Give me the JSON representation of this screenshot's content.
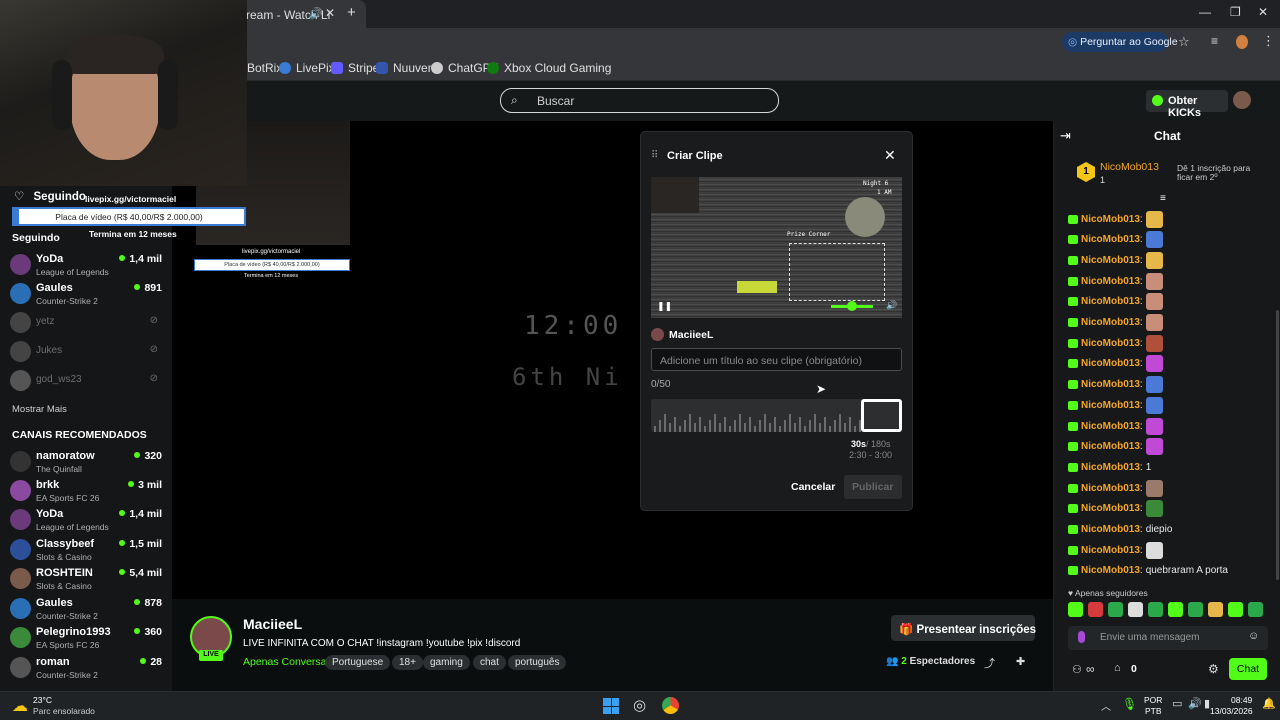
{
  "browser": {
    "tab_title": "ream - Watch Li",
    "bookmarks": [
      "BotRix",
      "LivePix",
      "Stripe",
      "Nuuvem",
      "ChatGPT",
      "Xbox Cloud Gaming"
    ],
    "google_button": "Perguntar ao Google"
  },
  "site": {
    "search_placeholder": "Buscar",
    "kicks_button": "Obter KICKs"
  },
  "overlay": {
    "following_label": "Seguindo",
    "livepix_url": "livepix.gg/victormaciel",
    "goal_text": "Placa de vídeo (R$ 40,00/R$ 2.000,00)",
    "goal_ends": "Termina em 12 meses",
    "goal_progress": 0.02
  },
  "sidebar": {
    "following_header": "Seguindo",
    "following": [
      {
        "name": "YoDa",
        "category": "League of Legends",
        "viewers": "1,4 mil",
        "online": true,
        "color": "#6b3a7a"
      },
      {
        "name": "Gaules",
        "category": "Counter-Strike 2",
        "viewers": "891",
        "online": true,
        "color": "#2a6fb5"
      },
      {
        "name": "yetz",
        "category": "",
        "viewers": "",
        "online": false,
        "color": "#555"
      },
      {
        "name": "Jukes",
        "category": "",
        "viewers": "",
        "online": false,
        "color": "#555"
      },
      {
        "name": "god_ws23",
        "category": "",
        "viewers": "",
        "online": false,
        "color": "#666"
      }
    ],
    "show_more": "Mostrar Mais",
    "recommended_header": "CANAIS RECOMENDADOS",
    "recommended": [
      {
        "name": "namoratow",
        "category": "The Quinfall",
        "viewers": "320",
        "color": "#333"
      },
      {
        "name": "brkk",
        "category": "EA Sports FC 26",
        "viewers": "3 mil",
        "color": "#8a4aa0"
      },
      {
        "name": "YoDa",
        "category": "League of Legends",
        "viewers": "1,4 mil",
        "color": "#6b3a7a"
      },
      {
        "name": "Classybeef",
        "category": "Slots & Casino",
        "viewers": "1,5 mil",
        "color": "#2c4f9a"
      },
      {
        "name": "ROSHTEIN",
        "category": "Slots & Casino",
        "viewers": "5,4 mil",
        "color": "#7a5a4a"
      },
      {
        "name": "Gaules",
        "category": "Counter-Strike 2",
        "viewers": "878",
        "color": "#2a6fb5"
      },
      {
        "name": "Pelegrino1993",
        "category": "EA Sports FC 26",
        "viewers": "360",
        "color": "#3a8a3a"
      },
      {
        "name": "roman",
        "category": "Counter-Strike 2",
        "viewers": "28",
        "color": "#555"
      }
    ]
  },
  "game": {
    "time_text": "12:00",
    "night_text": "6th Ni"
  },
  "modal": {
    "title": "Criar Clipe",
    "clip_author": "MaciieeL",
    "title_placeholder": "Adicione um título ao seu clipe (obrigatório)",
    "char_count": "0/50",
    "duration": "30s",
    "max_duration": "/ 180s",
    "range": "2:30 - 3:00",
    "cancel": "Cancelar",
    "publish": "Publicar",
    "preview_night": "Night 6",
    "preview_time": "1 AM",
    "preview_label": "Prize Corner"
  },
  "stream": {
    "channel": "MaciieeL",
    "live_badge": "LIVE",
    "title": "LIVE INFINITA COM O CHAT !instagram !youtube !pix !discord",
    "category": "Apenas Conversa",
    "tags": [
      "Portuguese",
      "18+",
      "gaming",
      "chat",
      "português"
    ],
    "gift_button": "Presentear inscrições",
    "viewers_count": "2",
    "viewers_label": "Espectadores"
  },
  "chat": {
    "header": "Chat",
    "top_gifter": {
      "rank": "1",
      "name": "NicoMob013",
      "count": "1",
      "hint": "Dê 1 inscrição para ficar em 2º"
    },
    "messages": [
      {
        "user": "NicoMob013",
        "text": "",
        "emote": "#e6b84a"
      },
      {
        "user": "NicoMob013",
        "text": "",
        "emote": "#4a7ad6"
      },
      {
        "user": "NicoMob013",
        "text": "",
        "emote": "#e6b84a"
      },
      {
        "user": "NicoMob013",
        "text": "",
        "emote": "#c98e7a"
      },
      {
        "user": "NicoMob013",
        "text": "",
        "emote": "#c98e7a"
      },
      {
        "user": "NicoMob013",
        "text": "",
        "emote": "#c98e7a"
      },
      {
        "user": "NicoMob013",
        "text": "",
        "emote": "#b0503a"
      },
      {
        "user": "NicoMob013",
        "text": "",
        "emote": "#c04ad6"
      },
      {
        "user": "NicoMob013",
        "text": "",
        "emote": "#4a7ad6"
      },
      {
        "user": "NicoMob013",
        "text": "",
        "emote": "#4a7ad6"
      },
      {
        "user": "NicoMob013",
        "text": "",
        "emote": "#c04ad6"
      },
      {
        "user": "NicoMob013",
        "text": "",
        "emote": "#c04ad6"
      },
      {
        "user": "NicoMob013",
        "text": "1",
        "emote": ""
      },
      {
        "user": "NicoMob013",
        "text": "",
        "emote": "#9a7a6a"
      },
      {
        "user": "NicoMob013",
        "text": "",
        "emote": "#3a8a3a"
      },
      {
        "user": "NicoMob013",
        "text": "diepio",
        "emote": ""
      },
      {
        "user": "NicoMob013",
        "text": "",
        "emote": "#dddddd"
      },
      {
        "user": "NicoMob013",
        "text": "quebraram A porta",
        "emote": ""
      }
    ],
    "followers_only": "Apenas seguidores",
    "input_placeholder": "Envie uma mensagem",
    "points": "0",
    "send_button": "Chat"
  },
  "taskbar": {
    "temp": "23°C",
    "weather": "Parc ensolarado",
    "lang": "POR",
    "layout": "PTB",
    "time": "08:49",
    "date": "13/03/2026"
  },
  "colors": {
    "accent": "#53fc18",
    "username": "#f5a623"
  }
}
